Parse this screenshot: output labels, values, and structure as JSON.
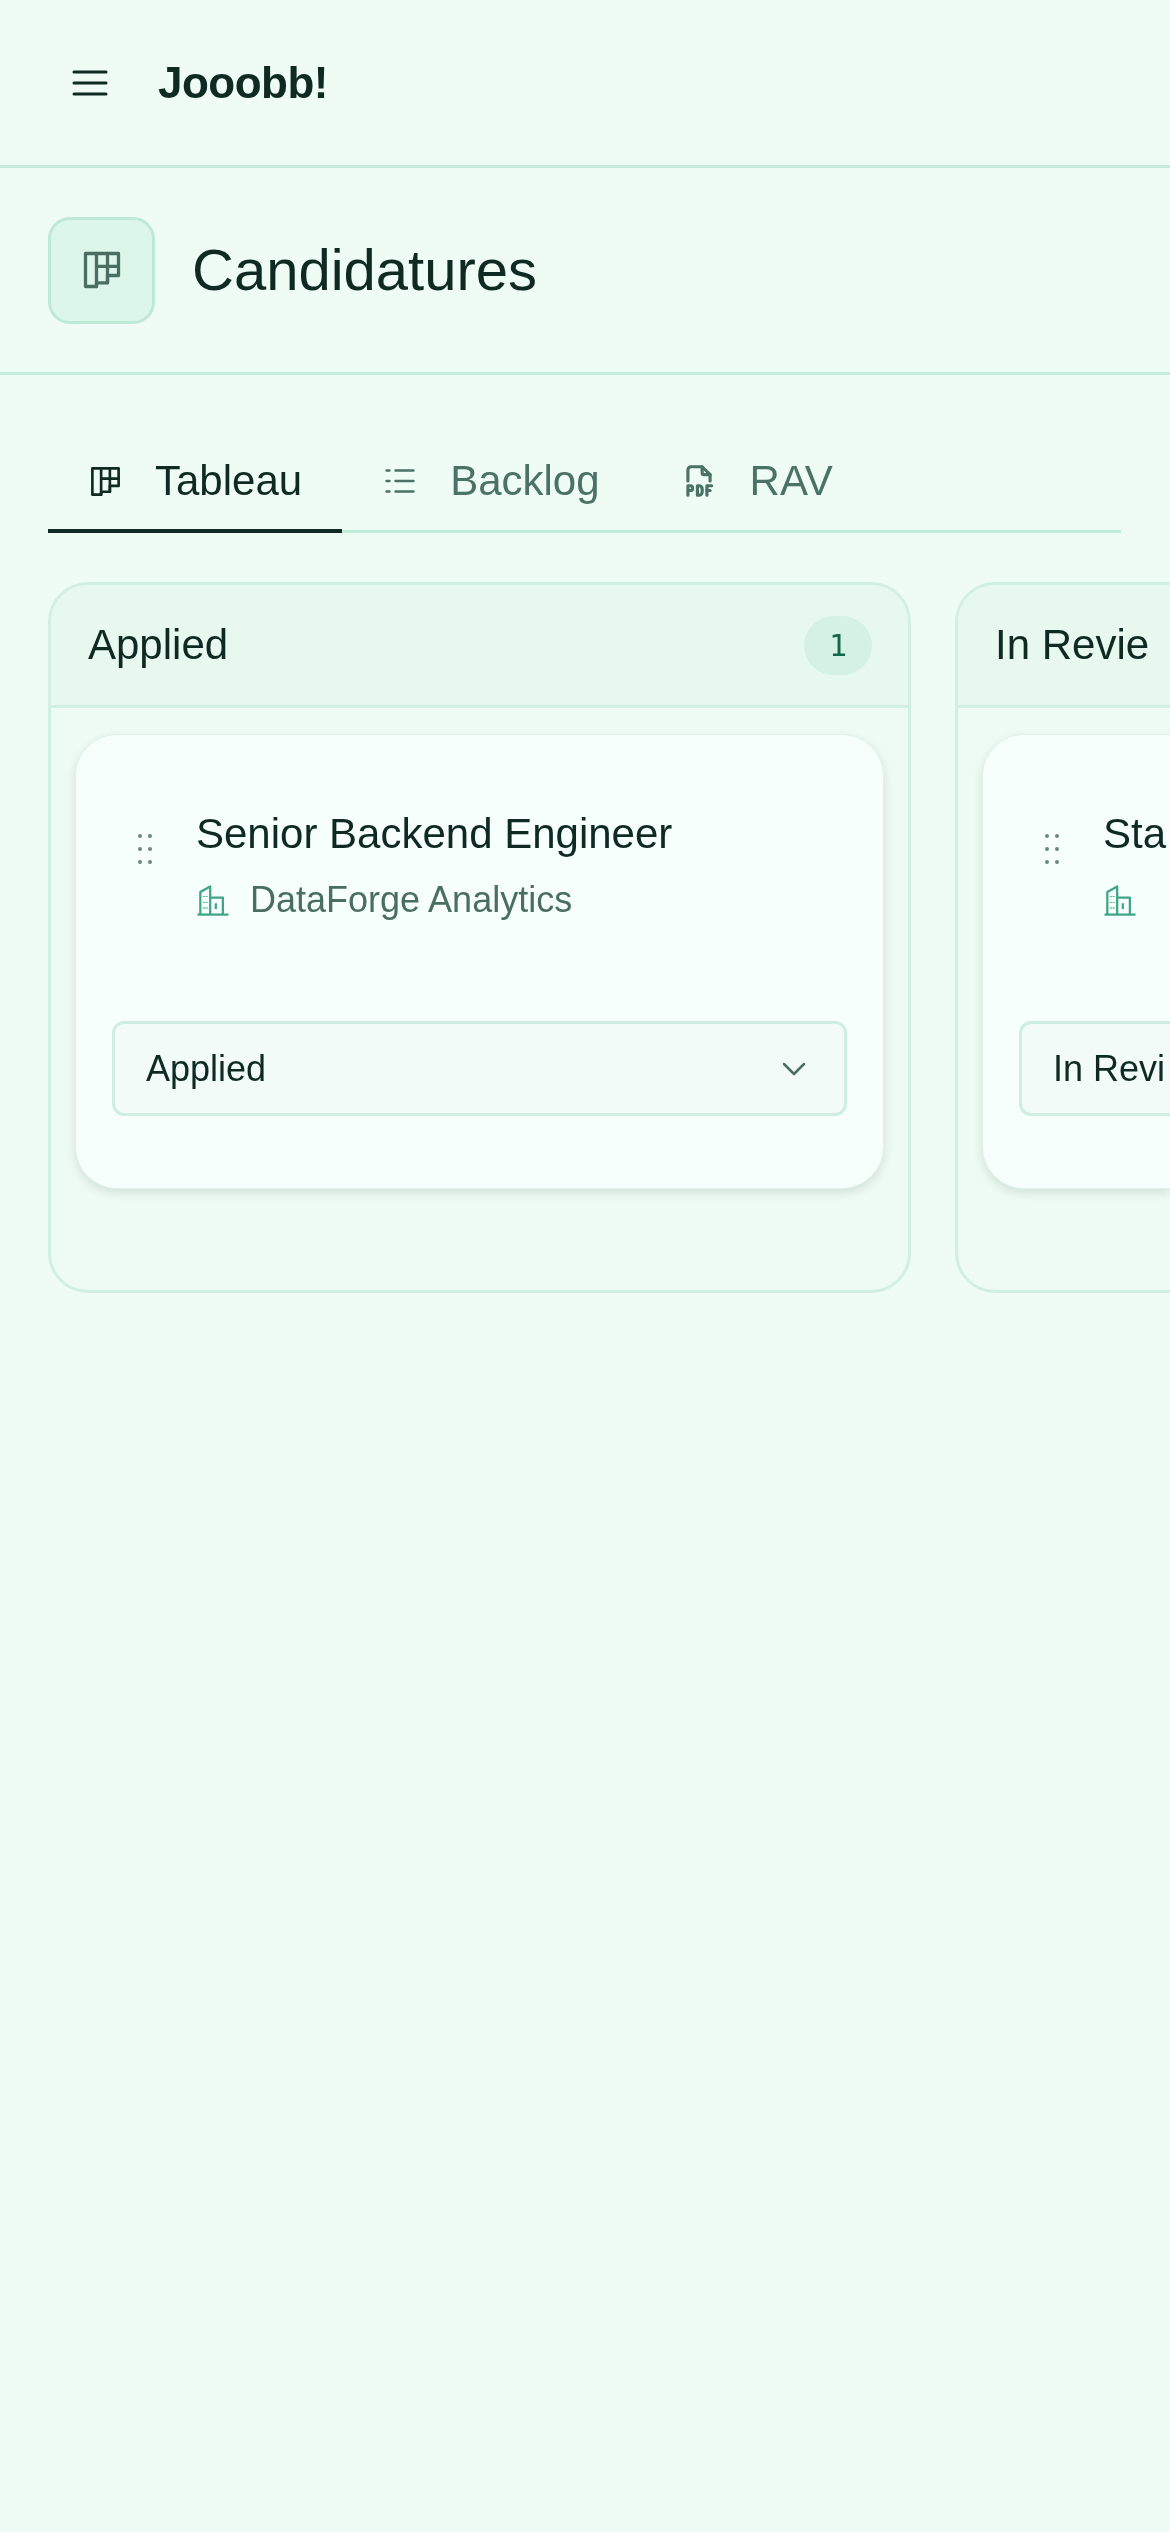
{
  "header": {
    "app_name": "Jooobb!"
  },
  "page_title": "Candidatures",
  "tabs": [
    {
      "label": "Tableau",
      "kind": "board",
      "selected": true
    },
    {
      "label": "Backlog",
      "kind": "list",
      "selected": false
    },
    {
      "label": "RAV",
      "kind": "pdf",
      "selected": false
    }
  ],
  "columns": [
    {
      "title": "Applied",
      "count": "1",
      "cut_off": false,
      "cards": [
        {
          "title": "Senior Backend Engineer",
          "company": "DataForge Analytics",
          "status": "Applied"
        }
      ]
    },
    {
      "title": "In Revie",
      "cut_off": true,
      "cards": [
        {
          "title": "Sta",
          "status": "In Revi"
        }
      ]
    }
  ]
}
